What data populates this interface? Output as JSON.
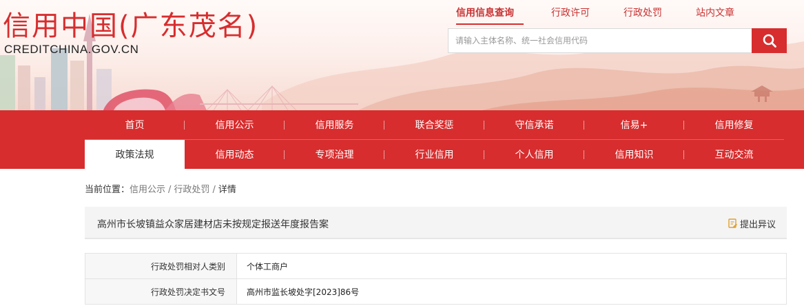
{
  "header": {
    "logo_title": "信用中国(广东茂名)",
    "logo_subtitle": "CREDITCHINA.GOV.CN",
    "top_links": [
      "信用信息查询",
      "行政许可",
      "行政处罚",
      "站内文章"
    ],
    "search": {
      "placeholder": "请输入主体名称、统一社会信用代码",
      "button_icon": "search-icon"
    }
  },
  "nav": {
    "row1": [
      "首页",
      "信用公示",
      "信用服务",
      "联合奖惩",
      "守信承诺",
      "信易+",
      "信用修复"
    ],
    "row2": [
      "政策法规",
      "信用动态",
      "专项治理",
      "行业信用",
      "个人信用",
      "信用知识",
      "互动交流"
    ]
  },
  "breadcrumb": {
    "prefix": "当前位置：",
    "items": [
      "信用公示",
      "行政处罚",
      "详情"
    ],
    "separator": "/"
  },
  "detail": {
    "title": "高州市长坡镇益众家居建材店未按规定报送年度报告案",
    "objection_label": "提出异议"
  },
  "table": {
    "rows": [
      {
        "label": "行政处罚相对人类别",
        "value": "个体工商户"
      },
      {
        "label": "行政处罚决定书文号",
        "value": "高州市监长坡处字[2023]86号"
      }
    ]
  },
  "colors": {
    "brand_red": "#d72d2e",
    "nav_active_bg": "#ffffff",
    "title_bg": "#f4f4f4"
  }
}
